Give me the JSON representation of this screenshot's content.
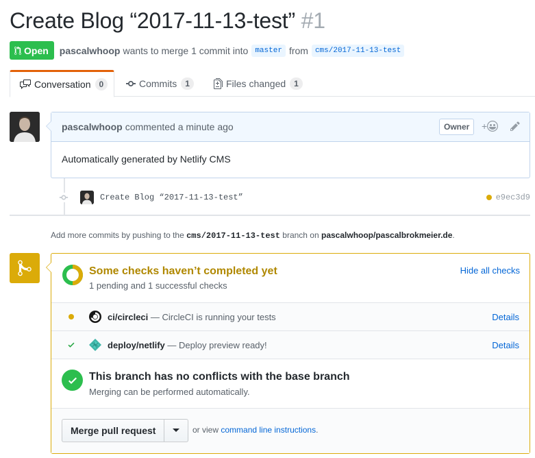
{
  "pr": {
    "title": "Create Blog “2017-11-13-test”",
    "number": "#1",
    "state": "Open",
    "author": "pascalwhoop",
    "merge_text": "wants to merge 1 commit into",
    "base_branch": "master",
    "from_text": "from",
    "head_branch": "cms/2017-11-13-test"
  },
  "tabs": [
    {
      "label": "Conversation",
      "count": "0",
      "icon": "comment-discussion-icon"
    },
    {
      "label": "Commits",
      "count": "1",
      "icon": "git-commit-icon"
    },
    {
      "label": "Files changed",
      "count": "1",
      "icon": "file-diff-icon"
    }
  ],
  "comment": {
    "author": "pascalwhoop",
    "action": "commented",
    "time": "a minute ago",
    "badge": "Owner",
    "reaction_plus": "+",
    "body": "Automatically generated by Netlify CMS"
  },
  "commit": {
    "message": "Create Blog “2017-11-13-test”",
    "sha": "e9ec3d9"
  },
  "hint": {
    "prefix": "Add more commits by pushing to the",
    "branch": "cms/2017-11-13-test",
    "mid": "branch on",
    "repo": "pascalwhoop/pascalbrokmeier.de",
    "suffix": "."
  },
  "checks": {
    "title": "Some checks haven’t completed yet",
    "summary": "1 pending and 1 successful checks",
    "hide_label": "Hide all checks",
    "items": [
      {
        "name": "ci/circleci",
        "desc": "— CircleCI is running your tests",
        "status": "pending",
        "details": "Details"
      },
      {
        "name": "deploy/netlify",
        "desc": "— Deploy preview ready!",
        "status": "success",
        "details": "Details"
      }
    ]
  },
  "conflicts": {
    "title": "This branch has no conflicts with the base branch",
    "sub": "Merging can be performed automatically."
  },
  "merge": {
    "button": "Merge pull request",
    "alt_prefix": "or view",
    "alt_link": "command line instructions",
    "alt_suffix": "."
  },
  "colors": {
    "open_green": "#2cbe4e",
    "pending_yellow": "#dbab09",
    "link_blue": "#0366d6",
    "tab_accent": "#e36209"
  }
}
